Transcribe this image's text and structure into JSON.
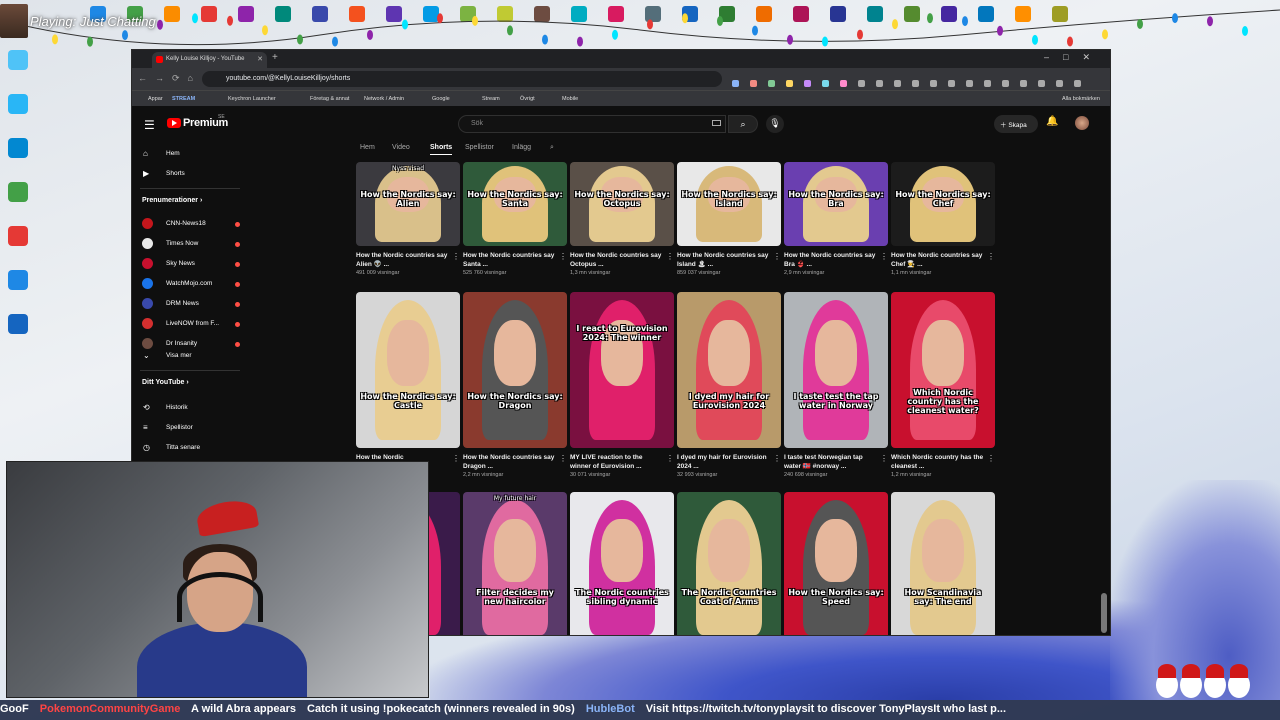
{
  "overlay": {
    "playing": "Playing: Just Chatting"
  },
  "browser": {
    "tab_title": "Kelly Louise Killjoy - YouTube",
    "url": "youtube.com/@KellyLouiseKilljoy/shorts",
    "bookmarks": [
      "Appar",
      "STREAM",
      "Keychron Launcher",
      "Företag & annat",
      "Network / Admin",
      "Google",
      "Stream",
      "Övrigt",
      "Mobile"
    ],
    "all_bookmarks": "Alla bokmärken"
  },
  "youtube": {
    "logo": "Premium",
    "logo_region": "SE",
    "search_placeholder": "Sök",
    "create_label": "Skapa",
    "sidebar": {
      "home": "Hem",
      "shorts": "Shorts",
      "subscriptions_heading": "Prenumerationer",
      "channels": [
        {
          "name": "CNN-News18",
          "color": "#c4161c"
        },
        {
          "name": "Times Now",
          "color": "#e8e8e8"
        },
        {
          "name": "Sky News",
          "color": "#c8102e"
        },
        {
          "name": "WatchMojo.com",
          "color": "#1a73e8"
        },
        {
          "name": "DRM News",
          "color": "#3949ab"
        },
        {
          "name": "LiveNOW from F...",
          "color": "#d32f2f"
        },
        {
          "name": "Dr Insanity",
          "color": "#6d4c41"
        }
      ],
      "show_more": "Visa mer",
      "you_heading": "Ditt YouTube",
      "history": "Historik",
      "playlists": "Spellistor",
      "watch_later": "Titta senare"
    },
    "channel_tabs": [
      "Hem",
      "Video",
      "Shorts",
      "Spellistor",
      "Inlägg"
    ],
    "active_tab": "Shorts",
    "shorts": [
      {
        "caption": "How the Nordics say: Alien",
        "title": "How the Nordic countries say Alien 👽 ...",
        "views": "491 009 visningar",
        "bg": "#3b3a3f",
        "hair": "#d9c08a",
        "top_badge": "Nyss visad"
      },
      {
        "caption": "How the Nordics say: Santa",
        "title": "How the Nordic countries say Santa ...",
        "views": "525 760 visningar",
        "bg": "#2f5a3a",
        "hair": "#e0c27a",
        "top_badge": ""
      },
      {
        "caption": "How the Nordics say: Octopus",
        "title": "How the Nordic countries say Octopus ...",
        "views": "1,3 mn visningar",
        "bg": "#5a5048",
        "hair": "#e3c98f",
        "top_badge": ""
      },
      {
        "caption": "How the Nordics say: Island",
        "title": "How the Nordic countries say Island 🏝 ...",
        "views": "859 037 visningar",
        "bg": "#e8e8e8",
        "hair": "#d8b97a",
        "top_badge": ""
      },
      {
        "caption": "How the Nordics say: Bra",
        "title": "How the Nordic countries say Bra 👙 ...",
        "views": "2,9 mn visningar",
        "bg": "#6a3fb0",
        "hair": "#e3c98f",
        "top_badge": ""
      },
      {
        "caption": "How the Nordics say: Chef",
        "title": "How the Nordic countries say Chef 👨‍🍳 ...",
        "views": "1,1 mn visningar",
        "bg": "#1c1c1c",
        "hair": "#e0c27a",
        "top_badge": ""
      },
      {
        "caption": "How the Nordics say: Castle",
        "title": "How the Nordic",
        "views": "",
        "bg": "#d6d6d6",
        "hair": "#e8cd92",
        "top_badge": ""
      },
      {
        "caption": "How the Nordics say: Dragon",
        "title": "How the Nordic countries say Dragon ...",
        "views": "2,2 mn visningar",
        "bg": "#8a3a2e",
        "hair": "#555555",
        "top_badge": ""
      },
      {
        "caption": "I react to Eurovision 2024: The winner",
        "title": "MY LIVE reaction to the winner of Eurovision ...",
        "views": "30 071 visningar",
        "bg": "#7a1040",
        "hair": "#e0206a",
        "top_badge": ""
      },
      {
        "caption": "I dyed my hair for Eurovision 2024",
        "title": "I dyed my hair for Eurovision 2024 ...",
        "views": "32 993 visningar",
        "bg": "#b89a6a",
        "hair": "#e04a5a",
        "top_badge": ""
      },
      {
        "caption": "I taste test the tap water in Norway",
        "title": "I taste test Norwegian tap water 🇳🇴 #norway ...",
        "views": "240 698 visningar",
        "bg": "#b0b4b8",
        "hair": "#e03a9a",
        "top_badge": ""
      },
      {
        "caption": "Which Nordic country has the cleanest water?",
        "title": "Which Nordic country has the cleanest ...",
        "views": "1,2 mn visningar",
        "bg": "#c8102e",
        "hair": "#e84a6a",
        "top_badge": ""
      },
      {
        "caption": "",
        "title": "",
        "views": "",
        "bg": "#3a1b4a",
        "hair": "#e0206a",
        "top_badge": ""
      },
      {
        "caption": "Filter decides my new haircolor",
        "title": "",
        "views": "",
        "bg": "#5a3a6a",
        "hair": "#e06aa0",
        "top_badge": "My future hair"
      },
      {
        "caption": "The Nordic countries sibling dynamic",
        "title": "",
        "views": "",
        "bg": "#e8e8ec",
        "hair": "#d030a0",
        "top_badge": ""
      },
      {
        "caption": "The Nordic Countries Coat of Arms",
        "title": "",
        "views": "",
        "bg": "#2f5a3a",
        "hair": "#e3c98f",
        "top_badge": ""
      },
      {
        "caption": "How the Nordics say: Speed",
        "title": "",
        "views": "",
        "bg": "#c8102e",
        "hair": "#555555",
        "top_badge": ""
      },
      {
        "caption": "How Scandinavia say: The end",
        "title": "",
        "views": "",
        "bg": "#d8d8d8",
        "hair": "#e3c98f",
        "top_badge": ""
      }
    ]
  },
  "ticker": {
    "user1": "GooF",
    "user2": "PokemonCommunityGame",
    "msg1": "A wild Abra appears",
    "msg2": "Catch it using !pokecatch (winners revealed in 90s)",
    "user3": "HubleBot",
    "msg3": "Visit https://twitch.tv/tonyplaysit to discover TonyPlaysIt who last p..."
  }
}
